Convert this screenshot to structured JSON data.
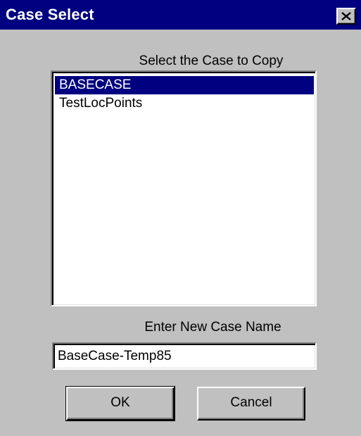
{
  "window": {
    "title": "Case Select",
    "close_icon": "close-icon"
  },
  "case_list": {
    "label": "Select the Case to Copy",
    "items": [
      {
        "label": "BASECASE",
        "selected": true
      },
      {
        "label": "TestLocPoints",
        "selected": false
      }
    ]
  },
  "new_case": {
    "label": "Enter New Case Name",
    "value": "BaseCase-Temp85"
  },
  "buttons": {
    "ok_label": "OK",
    "cancel_label": "Cancel"
  },
  "colors": {
    "title_bar": "#000080",
    "dialog_face": "#c0c0c0",
    "selection": "#000080"
  }
}
